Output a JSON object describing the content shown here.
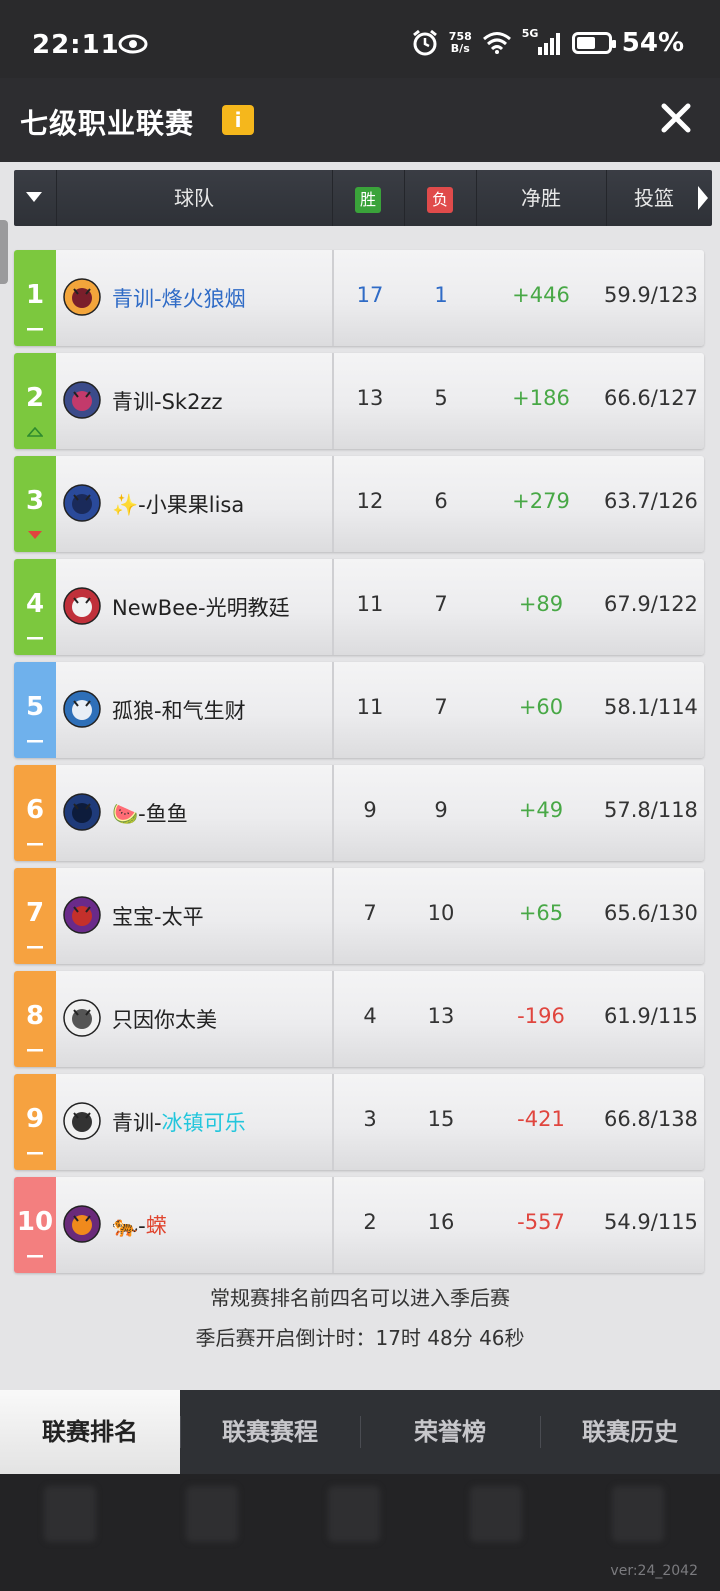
{
  "status": {
    "time": "22:11",
    "speed_top": "758",
    "speed_bottom": "B/s",
    "network": "5G",
    "battery": "54%"
  },
  "titlebar": {
    "title": "七级职业联赛",
    "info_label": "i"
  },
  "table": {
    "headers": {
      "team": "球队",
      "win": "胜",
      "loss": "负",
      "net": "净胜",
      "shoot": "投篮"
    },
    "rows": [
      {
        "rank": "1",
        "prefix": "",
        "name": "青训-烽火狼烟",
        "w": "17",
        "l": "1",
        "net": "+446",
        "shoot": "59.9/123",
        "bar": "#7cc83e"
      },
      {
        "rank": "2",
        "prefix": "",
        "name": "青训-Sk2zz",
        "w": "13",
        "l": "5",
        "net": "+186",
        "shoot": "66.6/127",
        "bar": "#7cc83e"
      },
      {
        "rank": "3",
        "prefix": "✨",
        "name": "-小果果lisa",
        "w": "12",
        "l": "6",
        "net": "+279",
        "shoot": "63.7/126",
        "bar": "#7cc83e"
      },
      {
        "rank": "4",
        "prefix": "",
        "name": "NewBee-光明教廷",
        "w": "11",
        "l": "7",
        "net": "+89",
        "shoot": "67.9/122",
        "bar": "#7cc83e"
      },
      {
        "rank": "5",
        "prefix": "",
        "name": "孤狼-和气生财",
        "w": "11",
        "l": "7",
        "net": "+60",
        "shoot": "58.1/114",
        "bar": "#6fb1ec"
      },
      {
        "rank": "6",
        "prefix": "🍉",
        "name": "-鱼鱼",
        "w": "9",
        "l": "9",
        "net": "+49",
        "shoot": "57.8/118",
        "bar": "#f6a240"
      },
      {
        "rank": "7",
        "prefix": "",
        "name": "宝宝-太平",
        "w": "7",
        "l": "10",
        "net": "+65",
        "shoot": "65.6/130",
        "bar": "#f6a240"
      },
      {
        "rank": "8",
        "prefix": "",
        "name": "只因你太美",
        "w": "4",
        "l": "13",
        "net": "-196",
        "shoot": "61.9/115",
        "bar": "#f6a240"
      },
      {
        "rank": "9",
        "prefix": "",
        "name_a": "青训-",
        "name_b": "冰镇可乐",
        "w": "3",
        "l": "15",
        "net": "-421",
        "shoot": "66.8/138",
        "bar": "#f6a240"
      },
      {
        "rank": "10",
        "prefix": "🐅",
        "name": "-蝾",
        "w": "2",
        "l": "16",
        "net": "-557",
        "shoot": "54.9/115",
        "bar": "#f37f7f"
      }
    ]
  },
  "notes": {
    "line1": "常规赛排名前四名可以进入季后赛",
    "line2": "季后赛开启倒计时：17时 48分 46秒"
  },
  "tabs": [
    "联赛排名",
    "联赛赛程",
    "荣誉榜",
    "联赛历史"
  ],
  "version": "ver:24_2042"
}
